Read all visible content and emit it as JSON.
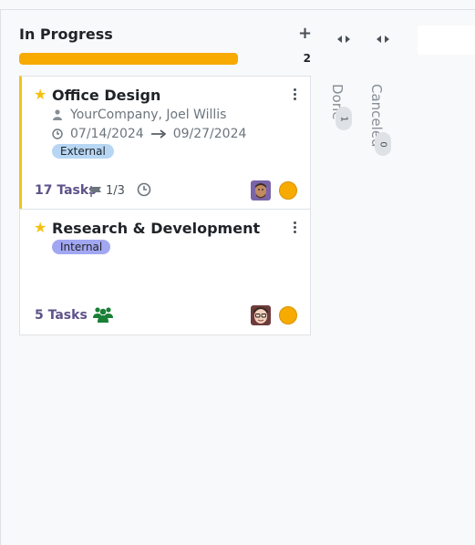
{
  "column": {
    "title": "In Progress",
    "add_label": "+",
    "progress_fraction": 1.0,
    "count": "2"
  },
  "cards": [
    {
      "title": "Office Design",
      "customer": "YourCompany, Joel Willis",
      "date_start": "07/14/2024",
      "date_end": "09/27/2024",
      "tag": "External",
      "tasks_label": "17 Tasks",
      "milestones": "1/3",
      "colors": {
        "accent": "#f0c419",
        "tag": "#b7d6f4"
      }
    },
    {
      "title": "Research & Development",
      "tag": "Internal",
      "tasks_label": "5 Tasks",
      "colors": {
        "tag": "#a2a7f2"
      }
    }
  ],
  "folded_columns": [
    {
      "label": "Done",
      "count": "1"
    },
    {
      "label": "Canceled",
      "count": "0"
    }
  ],
  "icons": {
    "star": "star-icon",
    "user": "user-icon",
    "clock": "clock-icon",
    "arrow": "long-arrow-right-icon",
    "flag": "flag-icon",
    "users": "users-group-icon",
    "kebab": "ellipsis-vertical-icon",
    "fold": "arrows-left-right-icon"
  },
  "accent_colors": {
    "progress": "#f7aa00",
    "star": "#f3c10f",
    "tasks_link": "#5e5289",
    "share_icon": "#1a7f37"
  }
}
